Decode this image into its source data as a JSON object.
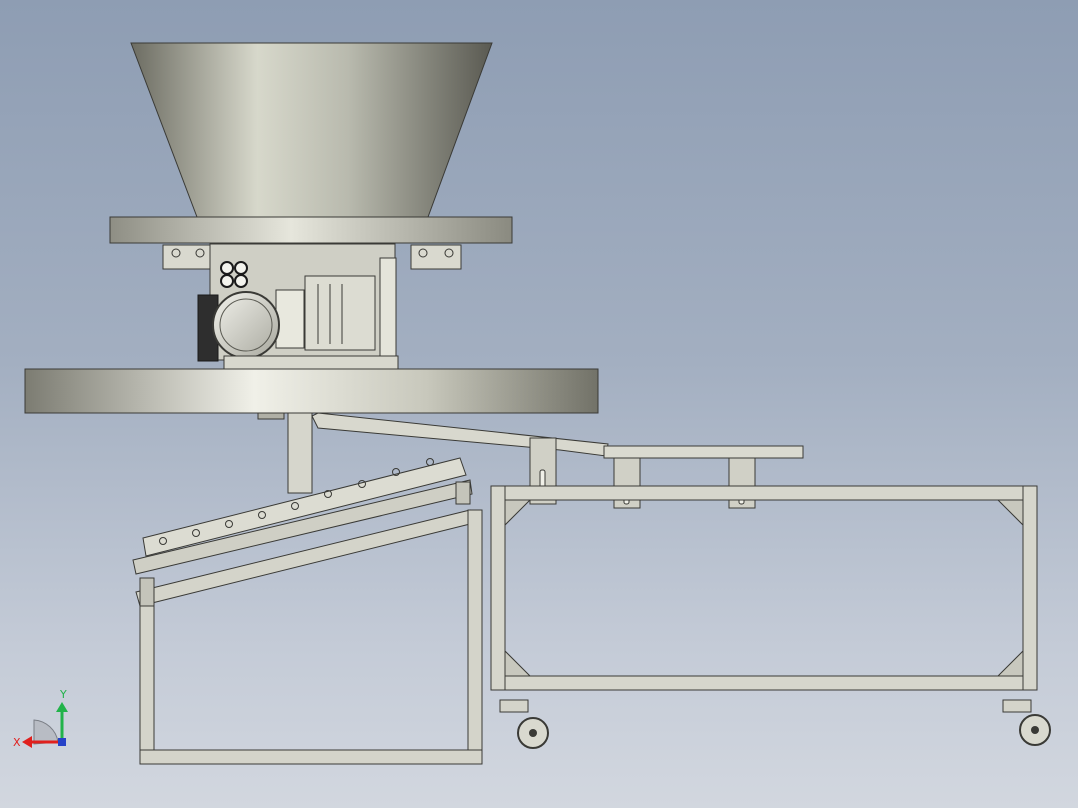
{
  "viewport": {
    "background_top": "#8e9db3",
    "background_bottom": "#d2d7df"
  },
  "model": {
    "parts": [
      "hopper",
      "upper-flange",
      "drive-motor",
      "lower-disc",
      "inclined-conveyor",
      "discharge-chute",
      "support-cart",
      "caster-wheels"
    ],
    "metal_color": "#c9c9bd",
    "frame_color": "#d4d4ca",
    "edge_color": "#3a3a36"
  },
  "triad": {
    "x_label": "X",
    "y_label": "Y",
    "x_color": "#e0201e",
    "y_color": "#22b34a",
    "z_color": "#2642c8"
  }
}
